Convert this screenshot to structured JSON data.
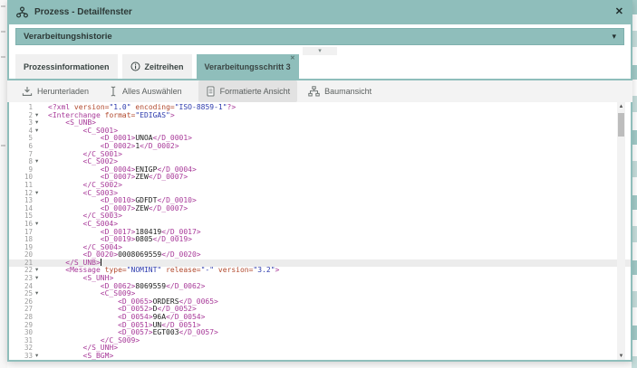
{
  "window": {
    "title": "Prozess - Detailfenster"
  },
  "panel": {
    "history_label": "Verarbeitungshistorie"
  },
  "tabs": [
    {
      "label": "Prozessinformationen",
      "active": false
    },
    {
      "label": "Zeitreihen",
      "active": false,
      "icon": "info-icon"
    },
    {
      "label": "Verarbeitungsschritt 3",
      "active": true,
      "closable": true
    }
  ],
  "toolbar": [
    {
      "label": "Herunterladen",
      "icon": "download-icon",
      "selected": false
    },
    {
      "label": "Alles Auswählen",
      "icon": "select-all-icon",
      "selected": false
    },
    {
      "label": "Formatierte Ansicht",
      "icon": "document-icon",
      "selected": true
    },
    {
      "label": "Baumansicht",
      "icon": "tree-icon",
      "selected": false
    }
  ],
  "icons": {
    "close": "✕",
    "tab_close": "✕",
    "caret_down": "▾",
    "handle_caret": "▾",
    "fold": "▾",
    "scroll_up": "▲",
    "scroll_down": "▼"
  },
  "colors": {
    "teal": "#8fbebb",
    "tealDark": "#7fb0ad",
    "titleText": "#2c3836",
    "tabText": "#3a4543",
    "tabBg": "#f0f0f0",
    "toolbarBg": "#f3f3f3",
    "toolbarText": "#5a5f5e",
    "chipBg": "#e2e2e2",
    "activeLine": "#ececec",
    "lineNum": "#9b9b9b",
    "codeTag": "#a83a99",
    "codeAttr": "#b24a2e",
    "codeVal": "#2d3bad",
    "codeText": "#1c1c1c"
  },
  "editor": {
    "active_line": 21,
    "fold_lines": [
      2,
      3,
      4,
      8,
      12,
      16,
      22,
      23,
      25,
      33
    ],
    "lines": [
      "<?xml version=\"1.0\" encoding=\"ISO-8859-1\"?>",
      "<Interchange format=\"EDIGAS\">",
      "    <S_UNB>",
      "        <C_S001>",
      "            <D_0001>UNOA</D_0001>",
      "            <D_0002>1</D_0002>",
      "        </C_S001>",
      "        <C_S002>",
      "            <D_0004>ENIGP</D_0004>",
      "            <D_0007>ZEW</D_0007>",
      "        </C_S002>",
      "        <C_S003>",
      "            <D_0010>GDFDT</D_0010>",
      "            <D_0007>ZEW</D_0007>",
      "        </C_S003>",
      "        <C_S004>",
      "            <D_0017>180419</D_0017>",
      "            <D_0019>0805</D_0019>",
      "        </C_S004>",
      "        <D_0020>0008069559</D_0020>",
      "    </S_UNB>",
      "    <Message type=\"NOMINT\" release=\"-\" version=\"3.2\">",
      "        <S_UNH>",
      "            <D_0062>8069559</D_0062>",
      "            <C_S009>",
      "                <D_0065>ORDERS</D_0065>",
      "                <D_0052>D</D_0052>",
      "                <D_0054>96A</D_0054>",
      "                <D_0051>UN</D_0051>",
      "                <D_0057>EGT003</D_0057>",
      "            </C_S009>",
      "        </S_UNH>",
      "        <S_BGM>"
    ]
  }
}
